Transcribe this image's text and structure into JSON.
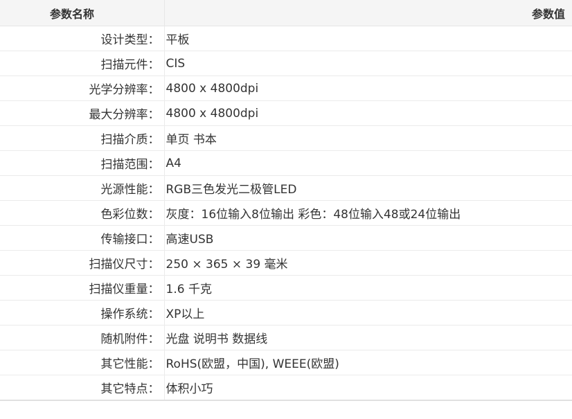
{
  "table": {
    "header_name": "参数名称",
    "header_value": "参数值",
    "rows": [
      {
        "name": "设计类型：",
        "value": "平板"
      },
      {
        "name": "扫描元件：",
        "value": "CIS"
      },
      {
        "name": "光学分辨率：",
        "value": "4800 x 4800dpi"
      },
      {
        "name": "最大分辨率：",
        "value": "4800 x 4800dpi"
      },
      {
        "name": "扫描介质：",
        "value": "单页 书本"
      },
      {
        "name": "扫描范围：",
        "value": "A4"
      },
      {
        "name": "光源性能：",
        "value": "RGB三色发光二极管LED"
      },
      {
        "name": "色彩位数：",
        "value": "灰度：16位输入8位输出 彩色：48位输入48或24位输出"
      },
      {
        "name": "传输接口：",
        "value": "高速USB"
      },
      {
        "name": "扫描仪尺寸：",
        "value": "250 × 365 × 39 毫米"
      },
      {
        "name": "扫描仪重量：",
        "value": "1.6 千克"
      },
      {
        "name": "操作系统：",
        "value": "XP以上"
      },
      {
        "name": "随机附件：",
        "value": "光盘 说明书 数据线"
      },
      {
        "name": "其它性能：",
        "value": "RoHS(欧盟，中国), WEEE(欧盟)"
      },
      {
        "name": "其它特点：",
        "value": "体积小巧"
      }
    ]
  }
}
